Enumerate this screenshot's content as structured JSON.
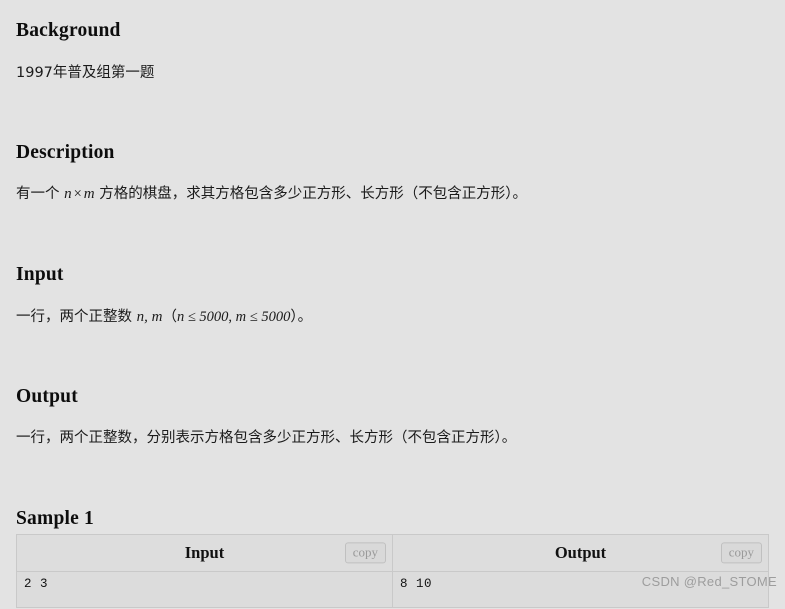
{
  "sections": {
    "background": {
      "title": "Background",
      "body": "1997年普及组第一题"
    },
    "description": {
      "title": "Description",
      "body_prefix": "有一个 ",
      "var_n": "n",
      "times": "×",
      "var_m": "m",
      "body_suffix": " 方格的棋盘，求其方格包含多少正方形、长方形（不包含正方形）。"
    },
    "input": {
      "title": "Input",
      "body_prefix": "一行，两个正整数 ",
      "vars": "n, m",
      "paren_open": "（",
      "cond_n": "n ≤ 5000",
      "comma": ", ",
      "cond_m": "m ≤ 5000",
      "paren_close": "）。"
    },
    "output": {
      "title": "Output",
      "body": "一行，两个正整数，分别表示方格包含多少正方形、长方形（不包含正方形）。"
    },
    "sample": {
      "title": "Sample 1",
      "columns": [
        "Input",
        "Output"
      ],
      "copy_label": "copy",
      "input_value": "2 3",
      "output_value": "8 10"
    }
  },
  "watermark": "CSDN @Red_STOME"
}
